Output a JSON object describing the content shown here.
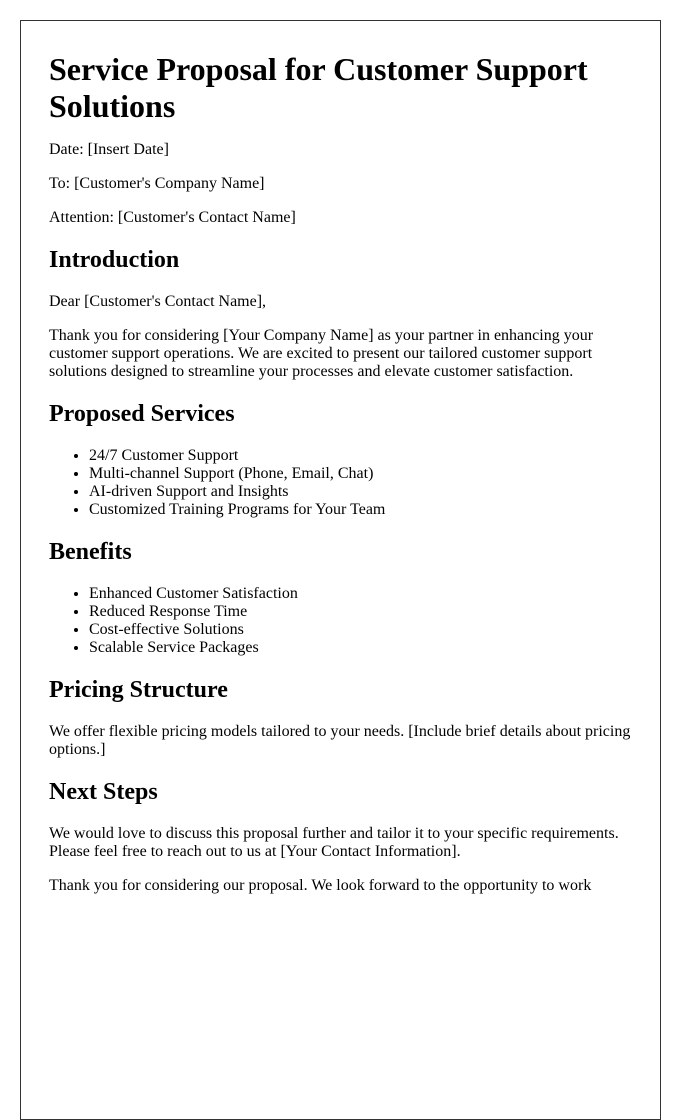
{
  "document": {
    "title": "Service Proposal for Customer Support Solutions",
    "date_line": "Date: [Insert Date]",
    "to_line": "To: [Customer's Company Name]",
    "attention_line": "Attention: [Customer's Contact Name]",
    "sections": {
      "introduction": {
        "heading": "Introduction",
        "greeting": "Dear [Customer's Contact Name],",
        "body": "Thank you for considering [Your Company Name] as your partner in enhancing your customer support operations. We are excited to present our tailored customer support solutions designed to streamline your processes and elevate customer satisfaction."
      },
      "proposed_services": {
        "heading": "Proposed Services",
        "items": [
          "24/7 Customer Support",
          "Multi-channel Support (Phone, Email, Chat)",
          "AI-driven Support and Insights",
          "Customized Training Programs for Your Team"
        ]
      },
      "benefits": {
        "heading": "Benefits",
        "items": [
          "Enhanced Customer Satisfaction",
          "Reduced Response Time",
          "Cost-effective Solutions",
          "Scalable Service Packages"
        ]
      },
      "pricing": {
        "heading": "Pricing Structure",
        "body": "We offer flexible pricing models tailored to your needs. [Include brief details about pricing options.]"
      },
      "next_steps": {
        "heading": "Next Steps",
        "body": "We would love to discuss this proposal further and tailor it to your specific requirements. Please feel free to reach out to us at [Your Contact Information].",
        "closing": "Thank you for considering our proposal. We look forward to the opportunity to work"
      }
    }
  }
}
